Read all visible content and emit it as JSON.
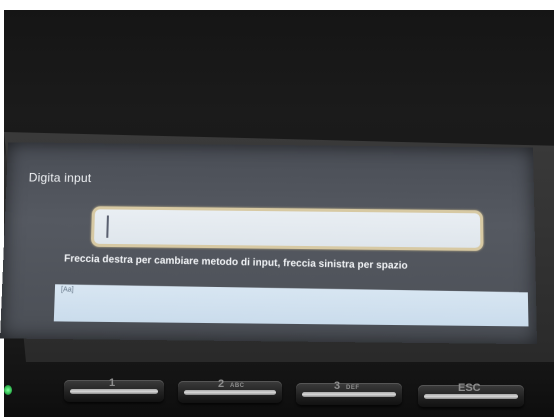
{
  "screen": {
    "title": "Digita input",
    "input_value": "",
    "hint": "Freccia destra per cambiare metodo di input, freccia sinistra per spazio",
    "status": "[Aa]"
  },
  "keypad": {
    "keys": [
      {
        "num": "1",
        "sub": ""
      },
      {
        "num": "2",
        "sub": "ABC"
      },
      {
        "num": "3",
        "sub": "DEF"
      },
      {
        "num": "ESC",
        "sub": ""
      }
    ]
  },
  "colors": {
    "screen_bg": "#51555d",
    "input_bg": "#e4eaf0",
    "input_border": "#d7c9a3",
    "status_bg": "#d2e1ef",
    "text": "#f2f4f7",
    "led": "#2fb54e"
  }
}
